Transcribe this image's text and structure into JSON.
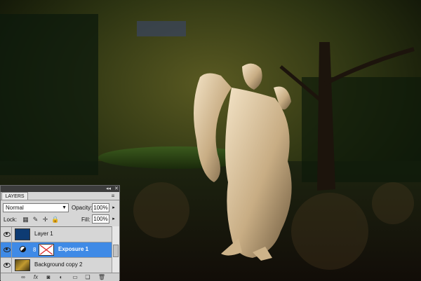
{
  "panel": {
    "tab_label": "LAYERS",
    "blend_mode": "Normal",
    "opacity_label": "Opacity:",
    "opacity_value": "100%",
    "lock_label": "Lock:",
    "fill_label": "Fill:",
    "fill_value": "100%",
    "layers": [
      {
        "name": "Layer 1",
        "selected": false
      },
      {
        "name": "Exposure 1",
        "selected": true
      },
      {
        "name": "Background copy 2",
        "selected": false
      }
    ],
    "lock_icons": [
      "transparency-lock-icon",
      "brush-lock-icon",
      "move-lock-icon",
      "padlock-icon"
    ],
    "bottom_icons": [
      "link-icon",
      "fx-icon",
      "mask-icon",
      "adjustment-icon",
      "folder-icon",
      "new-layer-icon",
      "trash-icon"
    ]
  },
  "colors": {
    "selection": "#3f8ae6",
    "panel_bg": "#d6d6d6",
    "layer1_thumb": "#0d3b73"
  }
}
